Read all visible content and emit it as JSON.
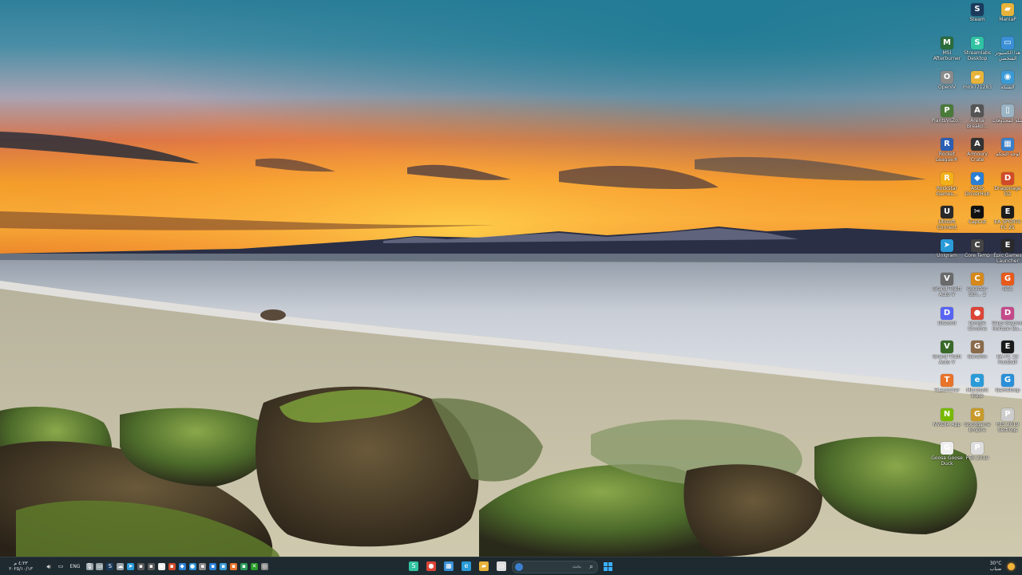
{
  "desktop": {
    "icons": [
      {
        "label": "Steam",
        "color": "#1b3a5c",
        "glyph": "S"
      },
      {
        "label": "ManiaP",
        "color": "#e8b33a",
        "glyph": "▰"
      },
      {
        "label": "MSI Afterburner",
        "color": "#2c6b3a",
        "glyph": "M"
      },
      {
        "label": "Streamlabs Desktop",
        "color": "#31c3a2",
        "glyph": "S"
      },
      {
        "label": "هذا الكمبيوتر الشخصي",
        "color": "#3a8fd6",
        "glyph": "▭"
      },
      {
        "label": "OpenIV",
        "color": "#8a8a8a",
        "glyph": "O"
      },
      {
        "label": "mo9771283",
        "color": "#e8b33a",
        "glyph": "▰"
      },
      {
        "label": "الشبكة",
        "color": "#3a9ad6",
        "glyph": "◉"
      },
      {
        "label": "PlantsVsZo...",
        "color": "#4a7a3a",
        "glyph": "P"
      },
      {
        "label": "Arena Breako...",
        "color": "#555555",
        "glyph": "A"
      },
      {
        "label": "سلة المحذوفات",
        "color": "#9ab4c4",
        "glyph": "▯"
      },
      {
        "label": "Rocket League®",
        "color": "#2b5fb3",
        "glyph": "R"
      },
      {
        "label": "Armoury Crate",
        "color": "#333333",
        "glyph": "A"
      },
      {
        "label": "لوحة التحكم",
        "color": "#3a7fc8",
        "glyph": "▦"
      },
      {
        "label": "Rockstar Games...",
        "color": "#f2b019",
        "glyph": "R"
      },
      {
        "label": "ASUS DriverHub",
        "color": "#2a7fd4",
        "glyph": "◆"
      },
      {
        "label": "Dragonage G2",
        "color": "#d04a2a",
        "glyph": "D"
      },
      {
        "label": "Ubisoft Connect",
        "color": "#2a2a2a",
        "glyph": "U"
      },
      {
        "label": "CapCut",
        "color": "#111111",
        "glyph": "✂"
      },
      {
        "label": "EA SPORTS FC 25",
        "color": "#1c1c1c",
        "glyph": "E"
      },
      {
        "label": "Unigram",
        "color": "#2a9bd8",
        "glyph": "➤"
      },
      {
        "label": "Core Temp",
        "color": "#444444",
        "glyph": "C"
      },
      {
        "label": "Epic Games Launcher",
        "color": "#2a2a2a",
        "glyph": "E"
      },
      {
        "label": "Grand Theft Auto V",
        "color": "#6a6a6a",
        "glyph": "V"
      },
      {
        "label": "Counter-Stri... 2",
        "color": "#d6891a",
        "glyph": "C"
      },
      {
        "label": "GCC",
        "color": "#e85a1a",
        "glyph": "G"
      },
      {
        "label": "Discord",
        "color": "#5865f2",
        "glyph": "D"
      },
      {
        "label": "Google Chrome",
        "color": "#db4437",
        "glyph": "●"
      },
      {
        "label": "Days Beyond Horizon Bu...",
        "color": "#c44a8a",
        "glyph": "D"
      },
      {
        "label": "Grand Theft Auto V",
        "color": "#3a6a2a",
        "glyph": "V"
      },
      {
        "label": "Genshin",
        "color": "#8a6a4a",
        "glyph": "G"
      },
      {
        "label": "EA FC 24 Football",
        "color": "#1a1a1a",
        "glyph": "E"
      },
      {
        "label": "TLauncher",
        "color": "#e8732a",
        "glyph": "T"
      },
      {
        "label": "Microsoft Edge",
        "color": "#2a9bd8",
        "glyph": "e"
      },
      {
        "label": "Gameloop",
        "color": "#2a8fd8",
        "glyph": "G"
      },
      {
        "label": "NVIDIA App",
        "color": "#76b900",
        "glyph": "N"
      },
      {
        "label": "Goodgame Empire",
        "color": "#c89a2a",
        "glyph": "G"
      },
      {
        "label": "PES 2019 Settings",
        "color": "#cccccc",
        "glyph": "P"
      },
      {
        "label": "Goose Goose Duck",
        "color": "#eeeeee",
        "glyph": "G"
      },
      {
        "label": "PES 2019",
        "color": "#dddddd",
        "glyph": "P"
      }
    ]
  },
  "taskbar": {
    "left_clock_time": "٤:٢٣ م",
    "left_clock_date": "٢٠٢٥/١٠/١٣",
    "language": "ENG",
    "tray_icons": [
      {
        "name": "mic",
        "color": "#9aa6ab",
        "glyph": "🎙"
      },
      {
        "name": "monitor",
        "color": "#9aa6ab",
        "glyph": "▭"
      },
      {
        "name": "steam",
        "color": "#1b3a5c",
        "glyph": "S"
      },
      {
        "name": "onedrive",
        "color": "#9aa6ab",
        "glyph": "☁"
      },
      {
        "name": "telegram",
        "color": "#2a9bd8",
        "glyph": "➤"
      },
      {
        "name": "app1",
        "color": "#5a5a5a",
        "glyph": "▪"
      },
      {
        "name": "app2",
        "color": "#5a5a5a",
        "glyph": "▪"
      },
      {
        "name": "app3",
        "color": "#eeeeee",
        "glyph": "▪"
      },
      {
        "name": "app4",
        "color": "#d04a2a",
        "glyph": "▪"
      },
      {
        "name": "app5",
        "color": "#2a7fd4",
        "glyph": "◆"
      },
      {
        "name": "app6",
        "color": "#2a8fd8",
        "glyph": "●"
      },
      {
        "name": "app7",
        "color": "#888888",
        "glyph": "▪"
      },
      {
        "name": "app8",
        "color": "#2a7fd4",
        "glyph": "▪"
      },
      {
        "name": "app9",
        "color": "#3a9ad6",
        "glyph": "▪"
      },
      {
        "name": "app10",
        "color": "#e8732a",
        "glyph": "▪"
      },
      {
        "name": "app11",
        "color": "#2a9b5a",
        "glyph": "▪"
      },
      {
        "name": "xbox",
        "color": "#2a9b2a",
        "glyph": "✕"
      },
      {
        "name": "app12",
        "color": "#888888",
        "glyph": "◎"
      }
    ],
    "pinned": [
      {
        "name": "streamlabs",
        "color": "#31c3a2",
        "glyph": "S"
      },
      {
        "name": "chrome",
        "color": "#db4437",
        "glyph": "●"
      },
      {
        "name": "calendar",
        "color": "#3a8fd6",
        "glyph": "▦"
      },
      {
        "name": "edge",
        "color": "#2a9bd8",
        "glyph": "e"
      },
      {
        "name": "file-explorer",
        "color": "#e8b33a",
        "glyph": "▰"
      },
      {
        "name": "task-view",
        "color": "#dddddd",
        "glyph": "▭"
      }
    ],
    "search_placeholder": "بحث",
    "weather_temp": "30°C",
    "weather_text": "ضباب"
  }
}
